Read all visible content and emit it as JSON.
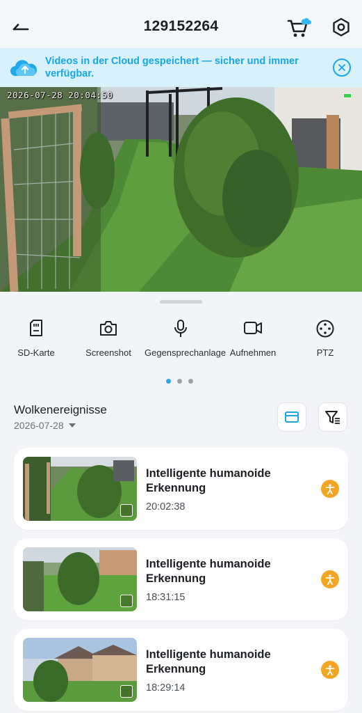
{
  "header": {
    "title": "129152264",
    "back_icon": "back-arrow-icon",
    "cart_icon": "cart-cloud-icon",
    "settings_icon": "settings-hex-icon"
  },
  "banner": {
    "text": "Videos in der Cloud gespeichert — sicher und immer verfügbar.",
    "icon": "cloud-upload-icon",
    "close_icon": "close-circle-icon",
    "color": "#19a6e6"
  },
  "live": {
    "timestamp": "2026-07-28 20:04:50"
  },
  "tools": [
    {
      "label": "SD-Karte",
      "icon": "sd-card-icon"
    },
    {
      "label": "Screenshot",
      "icon": "camera-icon"
    },
    {
      "label": "Gegensprechanlage",
      "icon": "microphone-icon"
    },
    {
      "label": "Aufnehmen",
      "icon": "video-record-icon"
    },
    {
      "label": "PTZ",
      "icon": "ptz-joystick-icon"
    }
  ],
  "pager": {
    "pages": 3,
    "active": 1
  },
  "events": {
    "title": "Wolkenereignisse",
    "date": "2026-07-28",
    "view_icon": "view-toggle-icon",
    "filter_icon": "filter-icon",
    "items": [
      {
        "title": "Intelligente humanoide Erkennung",
        "time": "20:02:38",
        "badge_icon": "human-detection-icon"
      },
      {
        "title": "Intelligente humanoide Erkennung",
        "time": "18:31:15",
        "badge_icon": "human-detection-icon"
      },
      {
        "title": "Intelligente humanoide Erkennung",
        "time": "18:29:14",
        "badge_icon": "human-detection-icon"
      }
    ]
  },
  "colors": {
    "accent": "#19a6e6",
    "badge": "#f5a524",
    "background": "#f2f4f7"
  }
}
